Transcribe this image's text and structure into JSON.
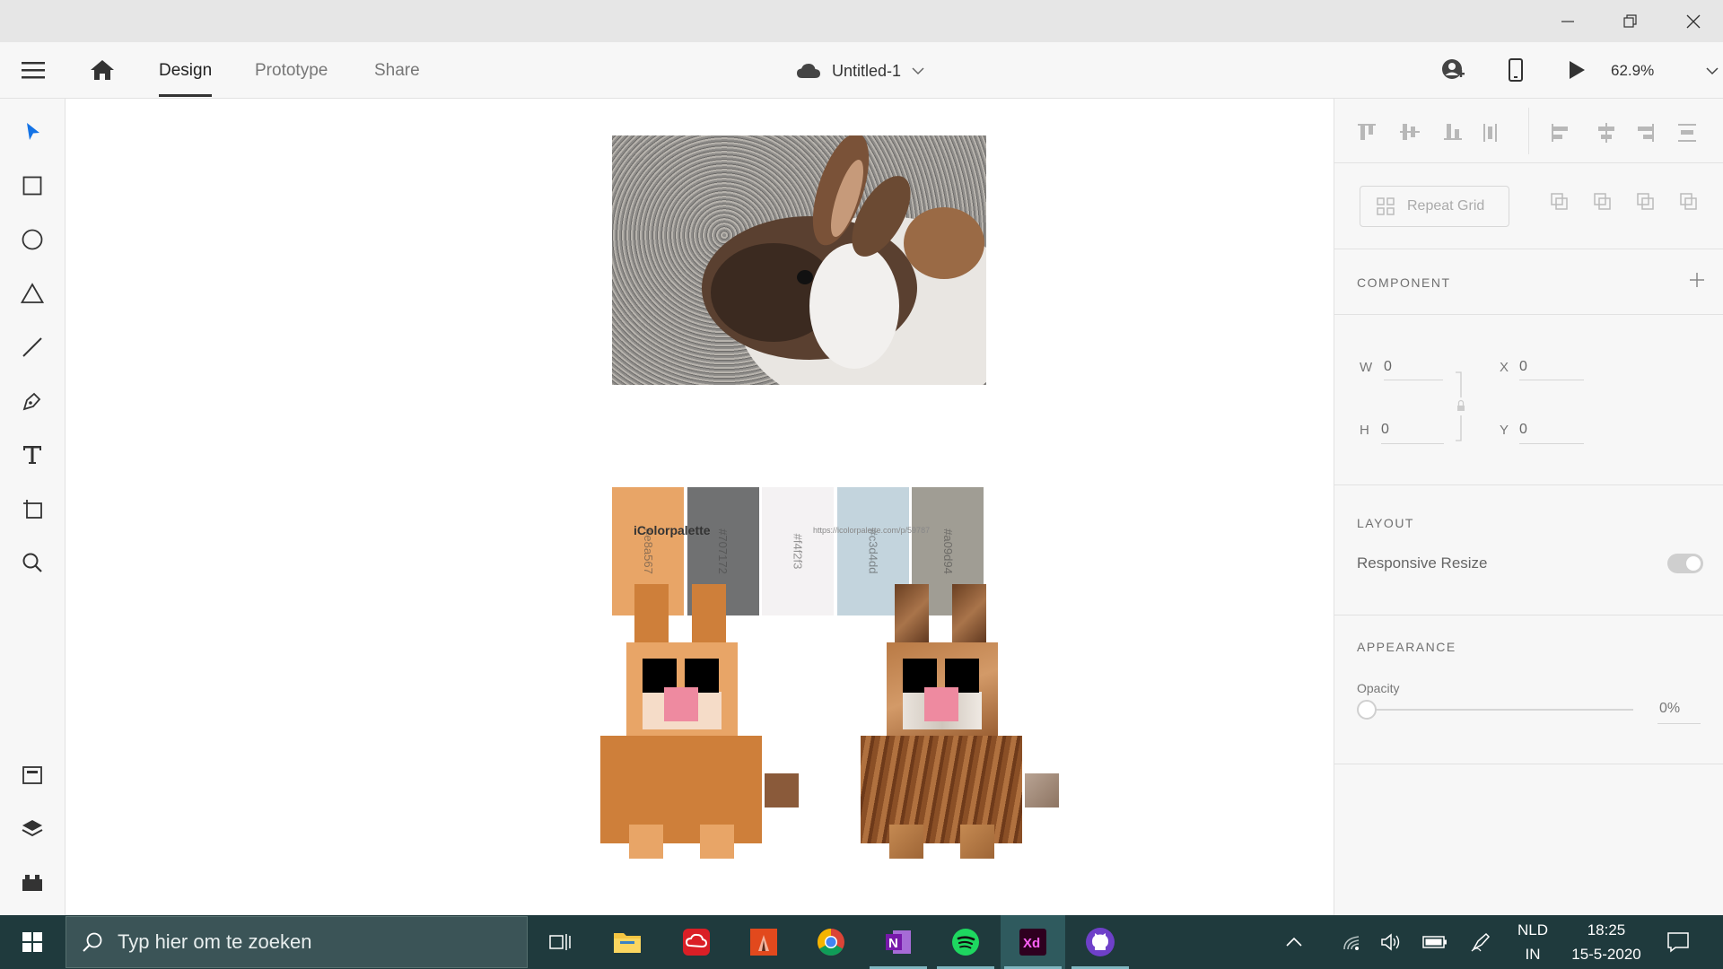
{
  "window": {
    "minimize_icon": "minimize-icon",
    "restore_icon": "restore-icon",
    "close_icon": "close-icon"
  },
  "appbar": {
    "tabs": [
      {
        "label": "Design"
      },
      {
        "label": "Prototype"
      },
      {
        "label": "Share"
      }
    ],
    "document_title": "Untitled-1",
    "zoom": "62.9%"
  },
  "artboard": {
    "palette": [
      {
        "hex": "#e8a567",
        "color": "#e8a567"
      },
      {
        "hex": "#707172",
        "color": "#707172"
      },
      {
        "hex": "#f4f2f3",
        "color": "#f4f2f3"
      },
      {
        "hex": "#c3d4dd",
        "color": "#c3d4dd"
      },
      {
        "hex": "#a09d94",
        "color": "#a09d94"
      }
    ],
    "brand": "iColorpalette",
    "source_url": "https://icolorpalette.com/p/59787"
  },
  "panel": {
    "repeat_grid": "Repeat Grid",
    "component_title": "COMPONENT",
    "w_label": "W",
    "w_value": "0",
    "h_label": "H",
    "h_value": "0",
    "x_label": "X",
    "x_value": "0",
    "y_label": "Y",
    "y_value": "0",
    "layout_title": "LAYOUT",
    "responsive_resize": "Responsive Resize",
    "appearance_title": "APPEARANCE",
    "opacity_label": "Opacity",
    "opacity_value": "0%",
    "opacity_fraction": 0
  },
  "taskbar": {
    "search_placeholder": "Typ hier om te zoeken",
    "language": "NLD",
    "language_sub": "IN",
    "time": "18:25",
    "date": "15-5-2020"
  }
}
